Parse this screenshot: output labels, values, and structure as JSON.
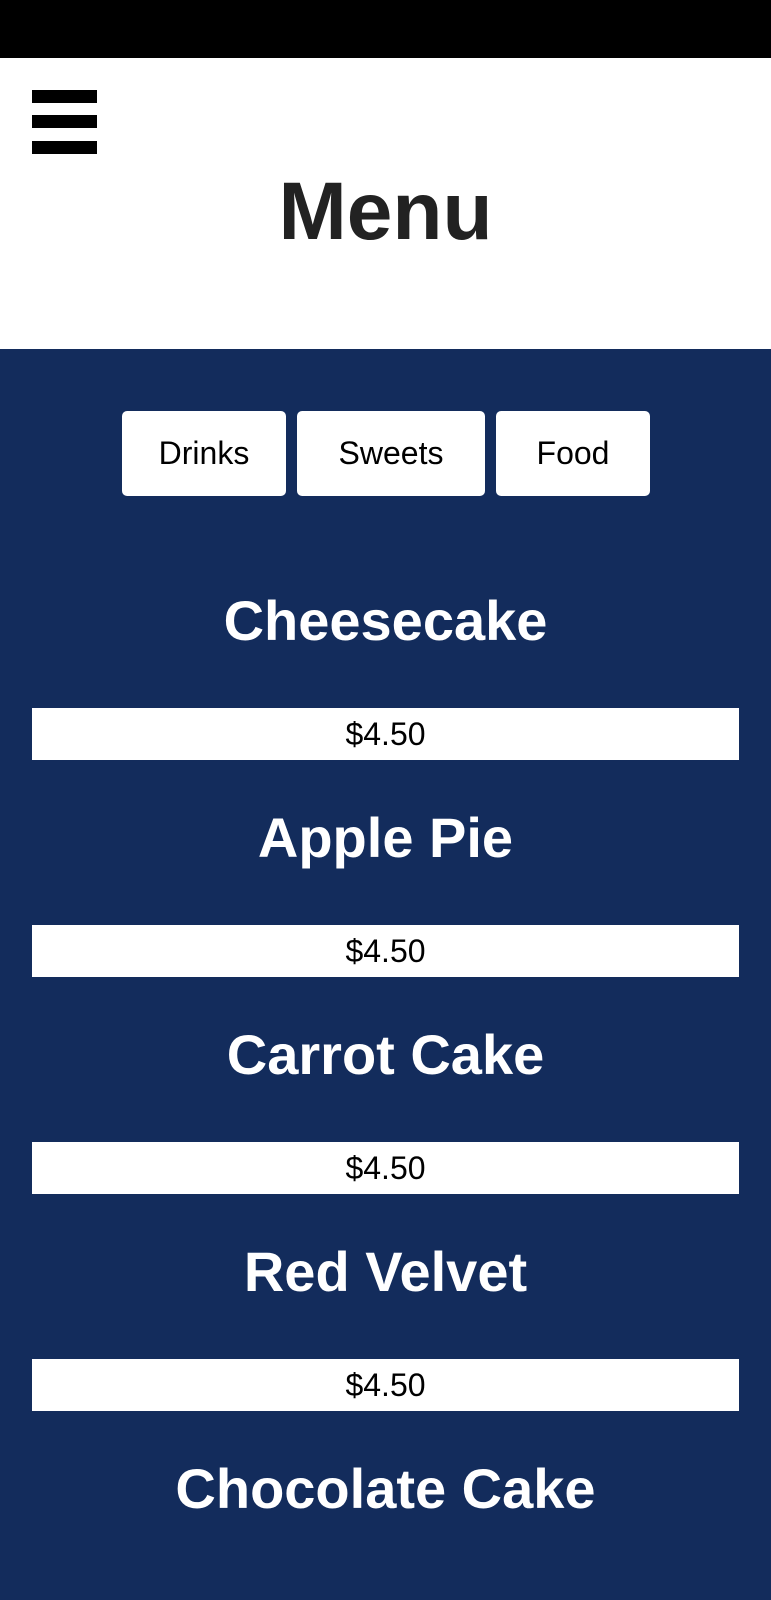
{
  "header": {
    "title": "Menu",
    "menu_icon": "hamburger-icon"
  },
  "tabs": [
    {
      "label": "Drinks"
    },
    {
      "label": "Sweets"
    },
    {
      "label": "Food"
    }
  ],
  "items": [
    {
      "name": "Cheesecake",
      "price": "$4.50"
    },
    {
      "name": "Apple Pie",
      "price": "$4.50"
    },
    {
      "name": "Carrot Cake",
      "price": "$4.50"
    },
    {
      "name": "Red Velvet",
      "price": "$4.50"
    },
    {
      "name": "Chocolate Cake",
      "price": ""
    }
  ],
  "colors": {
    "header_bg": "#ffffff",
    "main_bg": "#132c5c",
    "status_bar": "#000000"
  }
}
